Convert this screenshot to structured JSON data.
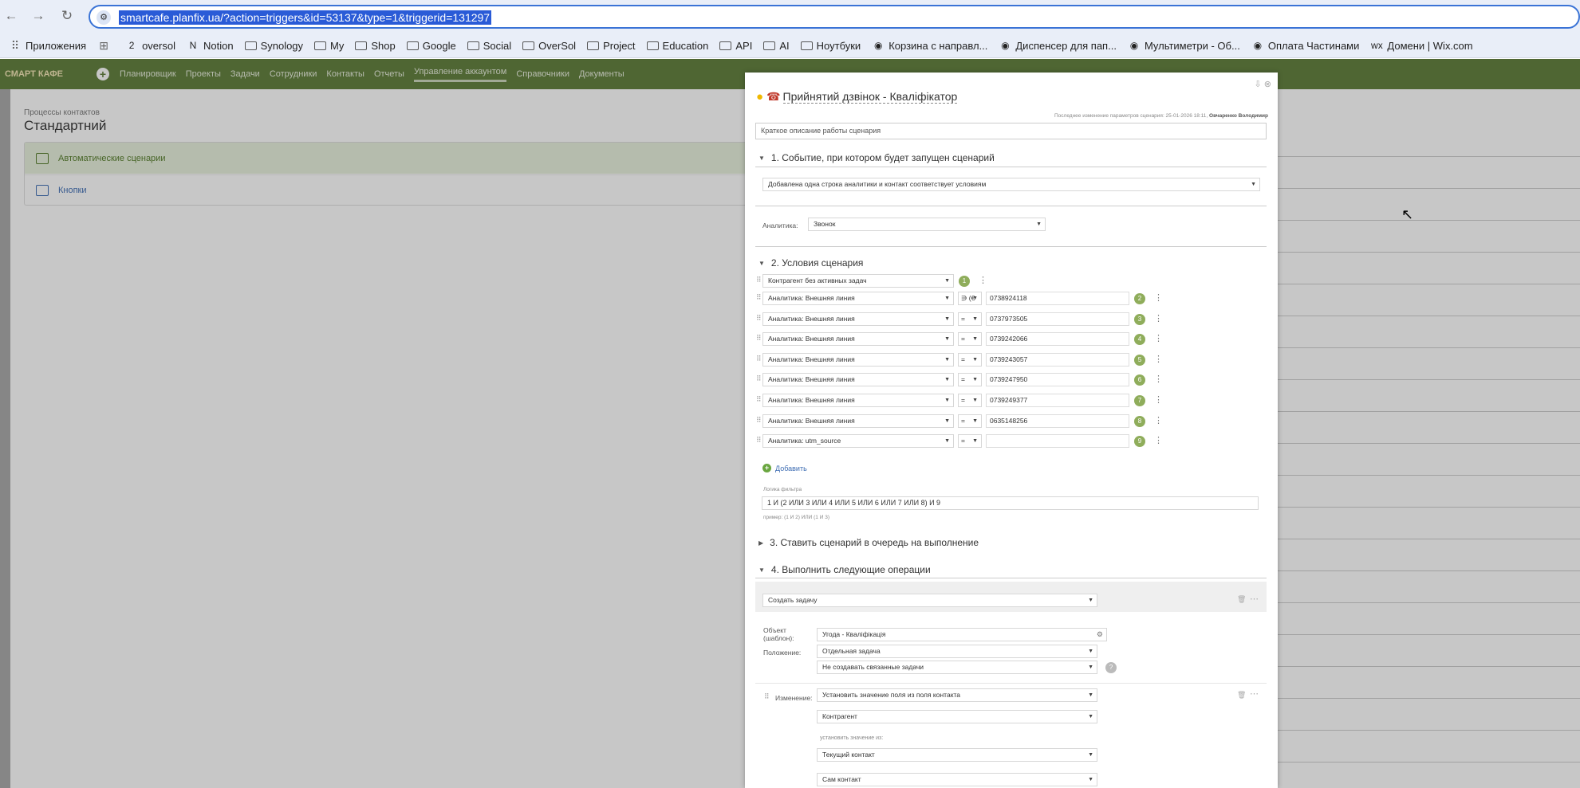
{
  "browser": {
    "url": "smartcafe.planfix.ua/?action=triggers&id=53137&type=1&triggerid=131297",
    "bookmarks": [
      {
        "icon": "grid-icon",
        "label": "Приложения"
      },
      {
        "icon": "apps-icon",
        "label": ""
      },
      {
        "icon": "badge-2-icon",
        "label": "oversol"
      },
      {
        "icon": "notion-icon",
        "label": "Notion"
      },
      {
        "icon": "folder-icon",
        "label": "Synology"
      },
      {
        "icon": "folder-icon",
        "label": "My"
      },
      {
        "icon": "folder-icon",
        "label": "Shop"
      },
      {
        "icon": "folder-icon",
        "label": "Google"
      },
      {
        "icon": "folder-icon",
        "label": "Social"
      },
      {
        "icon": "folder-icon",
        "label": "OverSol"
      },
      {
        "icon": "folder-icon",
        "label": "Project"
      },
      {
        "icon": "folder-icon",
        "label": "Education"
      },
      {
        "icon": "folder-icon",
        "label": "API"
      },
      {
        "icon": "folder-icon",
        "label": "AI"
      },
      {
        "icon": "folder-icon",
        "label": "Ноутбуки"
      },
      {
        "icon": "site-icon",
        "label": "Корзина с направл..."
      },
      {
        "icon": "site-icon",
        "label": "Диспенсер для пап..."
      },
      {
        "icon": "site-icon",
        "label": "Мультиметри - Об..."
      },
      {
        "icon": "site-icon",
        "label": "Оплата Частинами"
      },
      {
        "icon": "wix-icon",
        "label": "Домени | Wix.com"
      }
    ]
  },
  "app": {
    "logo": "СМАРТ КАФЕ",
    "nav": [
      "Планировщик",
      "Проекты",
      "Задачи",
      "Сотрудники",
      "Контакты",
      "Отчеты",
      "Управление аккаунтом",
      "Справочники",
      "Документы"
    ],
    "active_nav": "Управление аккаунтом"
  },
  "page": {
    "breadcrumb": "Процессы контактов",
    "title": "Стандартний",
    "items": [
      "Автоматические сценарии",
      "Кнопки"
    ]
  },
  "modal": {
    "title": "Прийнятий дзвінок - Кваліфікатор",
    "meta_prefix": "Последнее изменение параметров сценария: 25-01-2026 18:11,",
    "meta_author": "Овчаренко Володимир",
    "description_placeholder": "Краткое описание работы сценария",
    "section1": "1. Событие, при котором будет запущен сценарий",
    "event": "Добавлена одна строка аналитики и контакт соответствует условиям",
    "analytics_label": "Аналитика:",
    "analytics_value": "Звонок",
    "section2": "2. Условия сценария",
    "conditions": [
      {
        "field": "Контрагент без активных задач",
        "op": "",
        "value": "",
        "num": "1"
      },
      {
        "field": "Аналитика: Внешняя линия",
        "op": "∋ (€",
        "value": "0738924118",
        "num": "2"
      },
      {
        "field": "Аналитика: Внешняя линия",
        "op": "=",
        "value": "0737973505",
        "num": "3"
      },
      {
        "field": "Аналитика: Внешняя линия",
        "op": "=",
        "value": "0739242066",
        "num": "4"
      },
      {
        "field": "Аналитика: Внешняя линия",
        "op": "=",
        "value": "0739243057",
        "num": "5"
      },
      {
        "field": "Аналитика: Внешняя линия",
        "op": "=",
        "value": "0739247950",
        "num": "6"
      },
      {
        "field": "Аналитика: Внешняя линия",
        "op": "=",
        "value": "0739249377",
        "num": "7"
      },
      {
        "field": "Аналитика: Внешняя линия",
        "op": "=",
        "value": "0635148256",
        "num": "8"
      },
      {
        "field": "Аналитика: utm_source",
        "op": "=",
        "value": "",
        "num": "9"
      }
    ],
    "add_label": "Добавить",
    "filter_logic_label": "Логика фильтра",
    "filter_logic": "1 И (2 ИЛИ 3 ИЛИ 4 ИЛИ 5 ИЛИ 6 ИЛИ 7 ИЛИ 8) И 9",
    "filter_example": "пример: (1 И 2) ИЛИ (1 И 3)",
    "section3": "3. Ставить сценарий в очередь на выполнение",
    "section4": "4. Выполнить следующие операции",
    "operation": "Создать задачу",
    "object_label": "Объект (шаблон):",
    "object_value": "Угода - Кваліфікація",
    "position_label": "Положение:",
    "position_value": "Отдельная задача",
    "related_value": "Не создавать связанные задачи",
    "change_label": "Изменение:",
    "change_value": "Установить значение поля из поля контакта",
    "field_value": "Контрагент",
    "set_from_label": "установить значение из:",
    "current_contact": "Текущий контакт",
    "self_contact": "Сам контакт"
  }
}
